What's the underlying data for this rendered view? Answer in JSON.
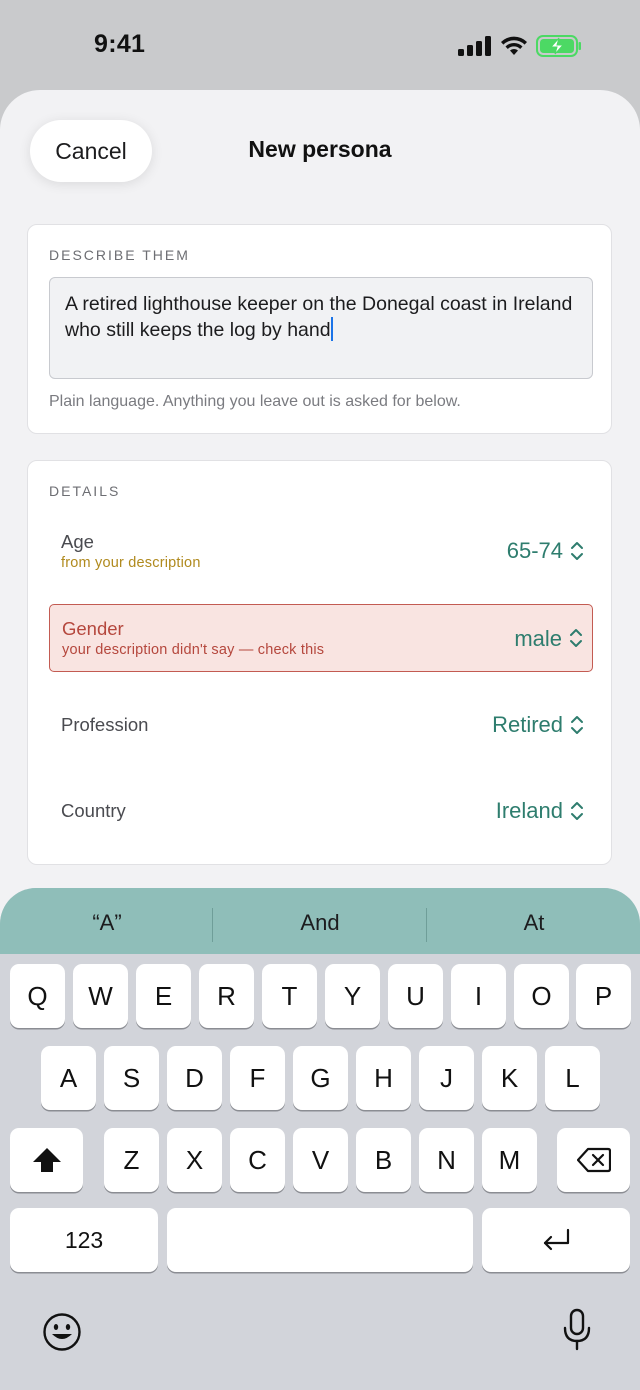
{
  "status_bar": {
    "time": "9:41"
  },
  "nav": {
    "cancel": "Cancel",
    "title": "New persona"
  },
  "describe": {
    "label": "DESCRIBE THEM",
    "text": "A retired lighthouse keeper on the Donegal coast in Ireland who still keeps the log by hand",
    "hint": "Plain language. Anything you leave out is asked for below."
  },
  "details": {
    "label": "DETAILS",
    "rows": [
      {
        "label": "Age",
        "sub": "from your description",
        "value": "65-74"
      },
      {
        "label": "Gender",
        "sub": "your description didn't say — check this",
        "value": "male"
      },
      {
        "label": "Profession",
        "value": "Retired"
      },
      {
        "label": "Country",
        "value": "Ireland"
      }
    ]
  },
  "colors": {
    "accent_value": "#2e7d6e",
    "inferred_note": "#b08a1e",
    "warning_text": "#b5473d",
    "warning_bg": "#f9e4e1",
    "caret": "#1b74e8"
  },
  "keyboard": {
    "suggestions": [
      "“A”",
      "And",
      "At"
    ],
    "row1": [
      "Q",
      "W",
      "E",
      "R",
      "T",
      "Y",
      "U",
      "I",
      "O",
      "P"
    ],
    "row2": [
      "A",
      "S",
      "D",
      "F",
      "G",
      "H",
      "J",
      "K",
      "L"
    ],
    "row3": [
      "Z",
      "X",
      "C",
      "V",
      "B",
      "N",
      "M"
    ],
    "numbers_key": "123",
    "icons": [
      "shift-icon",
      "backspace-icon",
      "return-icon",
      "emoji-icon",
      "microphone-icon"
    ]
  }
}
